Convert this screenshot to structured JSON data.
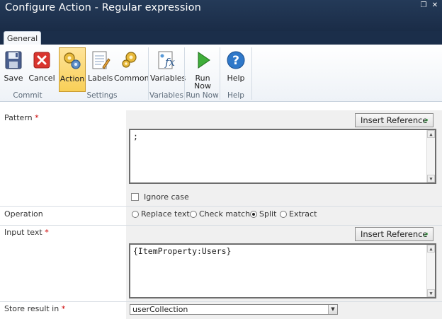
{
  "window": {
    "title": "Configure Action - Regular expression",
    "restore_glyph": "❐",
    "close_glyph": "✕"
  },
  "tabs": [
    {
      "label": "General"
    }
  ],
  "ribbon": {
    "buttons": {
      "save": {
        "label": "Save",
        "icon": "floppy-disk-icon"
      },
      "cancel": {
        "label": "Cancel",
        "icon": "red-x-icon"
      },
      "action": {
        "label": "Action",
        "icon": "gears-icon"
      },
      "labels": {
        "label": "Labels",
        "icon": "labels-notepad-icon"
      },
      "common": {
        "label": "Common",
        "icon": "gear-icon"
      },
      "variables": {
        "label": "Variables",
        "icon": "fx-variables-icon"
      },
      "run_now": {
        "label_line1": "Run",
        "label_line2": "Now",
        "icon": "play-icon"
      },
      "help": {
        "label": "Help",
        "icon": "help-question-icon"
      }
    },
    "groups": {
      "commit": "Commit",
      "settings": "Settings",
      "variables": "Variables",
      "run_now": "Run Now",
      "help": "Help"
    }
  },
  "form": {
    "pattern": {
      "label": "Pattern",
      "required_mark": "*",
      "insert_reference": "Insert Reference",
      "value": ";",
      "ignore_case_label": "Ignore case",
      "ignore_case_checked": false
    },
    "operation": {
      "label": "Operation",
      "options": {
        "replace": "Replace text",
        "check": "Check match",
        "split": "Split",
        "extract": "Extract"
      },
      "selected": "Split"
    },
    "input_text": {
      "label": "Input text",
      "required_mark": "*",
      "insert_reference": "Insert Reference",
      "value": "{ItemProperty:Users}"
    },
    "store_result": {
      "label": "Store result in",
      "required_mark": "*",
      "value": "userCollection"
    }
  },
  "colors": {
    "titlebar": "#243a58",
    "selected_button": "#f8cf57",
    "required": "#cc0000"
  }
}
